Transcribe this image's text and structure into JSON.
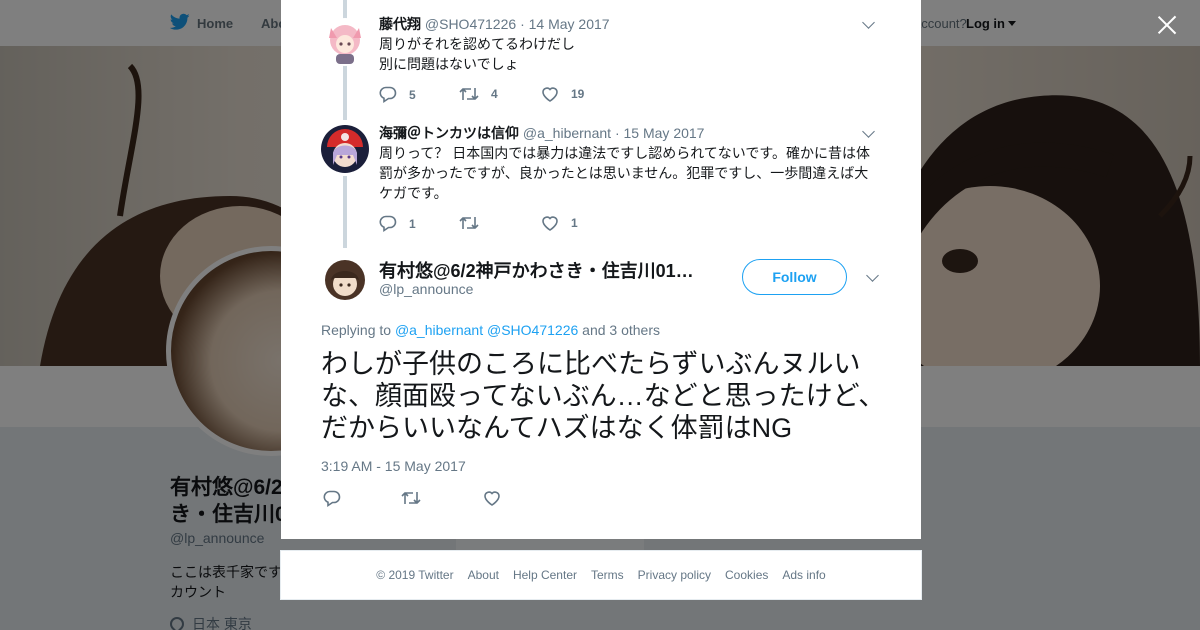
{
  "background": {
    "nav": {
      "home": "Home",
      "about": "Abo",
      "have_account": "account?",
      "login": "Log in"
    },
    "profile": {
      "name": "有村悠@6/2神戸かわさき・住吉川01…",
      "name_visible": "有村悠@6/2\nき・住吉川0",
      "handle": "@lp_announce",
      "bio": "ここは表千家です\nカウント",
      "location": "日本 東京"
    }
  },
  "replies": [
    {
      "name": "藤代翔",
      "handle": "@SHO471226",
      "separator": "·",
      "date": "14 May 2017",
      "text": "周りがそれを認めてるわけだし\n別に問題はないでしょ",
      "reply_count": "5",
      "retweet_count": "4",
      "like_count": "19"
    },
    {
      "name": "海彌＠トンカツは信仰",
      "handle": "@a_hibernant",
      "separator": "·",
      "date": "15 May 2017",
      "text": "周りって？ 日本国内では暴力は違法ですし認められてないです。確かに昔は体罰が多かったですが、良かったとは思いません。犯罪ですし、一歩間違えば大ケガです。",
      "reply_count": "1",
      "retweet_count": "",
      "like_count": "1"
    }
  ],
  "tweet": {
    "name": "有村悠@6/2神戸かわさき・住吉川01…",
    "handle": "@lp_announce",
    "follow_label": "Follow",
    "replying_prefix": "Replying to",
    "replying_to_1": "@a_hibernant",
    "replying_to_2": "@SHO471226",
    "replying_suffix": "and 3 others",
    "text": "わしが子供のころに比べたらずいぶんヌルいな、顔面殴ってないぶん…などと思ったけど、だからいいなんてハズはなく体罰はNG",
    "timestamp": "3:19 AM - 15 May 2017"
  },
  "footer": {
    "copyright": "© 2019 Twitter",
    "links": [
      "About",
      "Help Center",
      "Terms",
      "Privacy policy",
      "Cookies",
      "Ads info"
    ]
  },
  "colors": {
    "accent": "#1da1f2",
    "muted": "#657786",
    "text": "#14171a",
    "thread": "#ccd6dd"
  },
  "icons": [
    "twitter-bird-icon",
    "close-icon",
    "reply-icon",
    "retweet-icon",
    "like-icon",
    "chevron-down-icon",
    "location-pin-icon"
  ]
}
